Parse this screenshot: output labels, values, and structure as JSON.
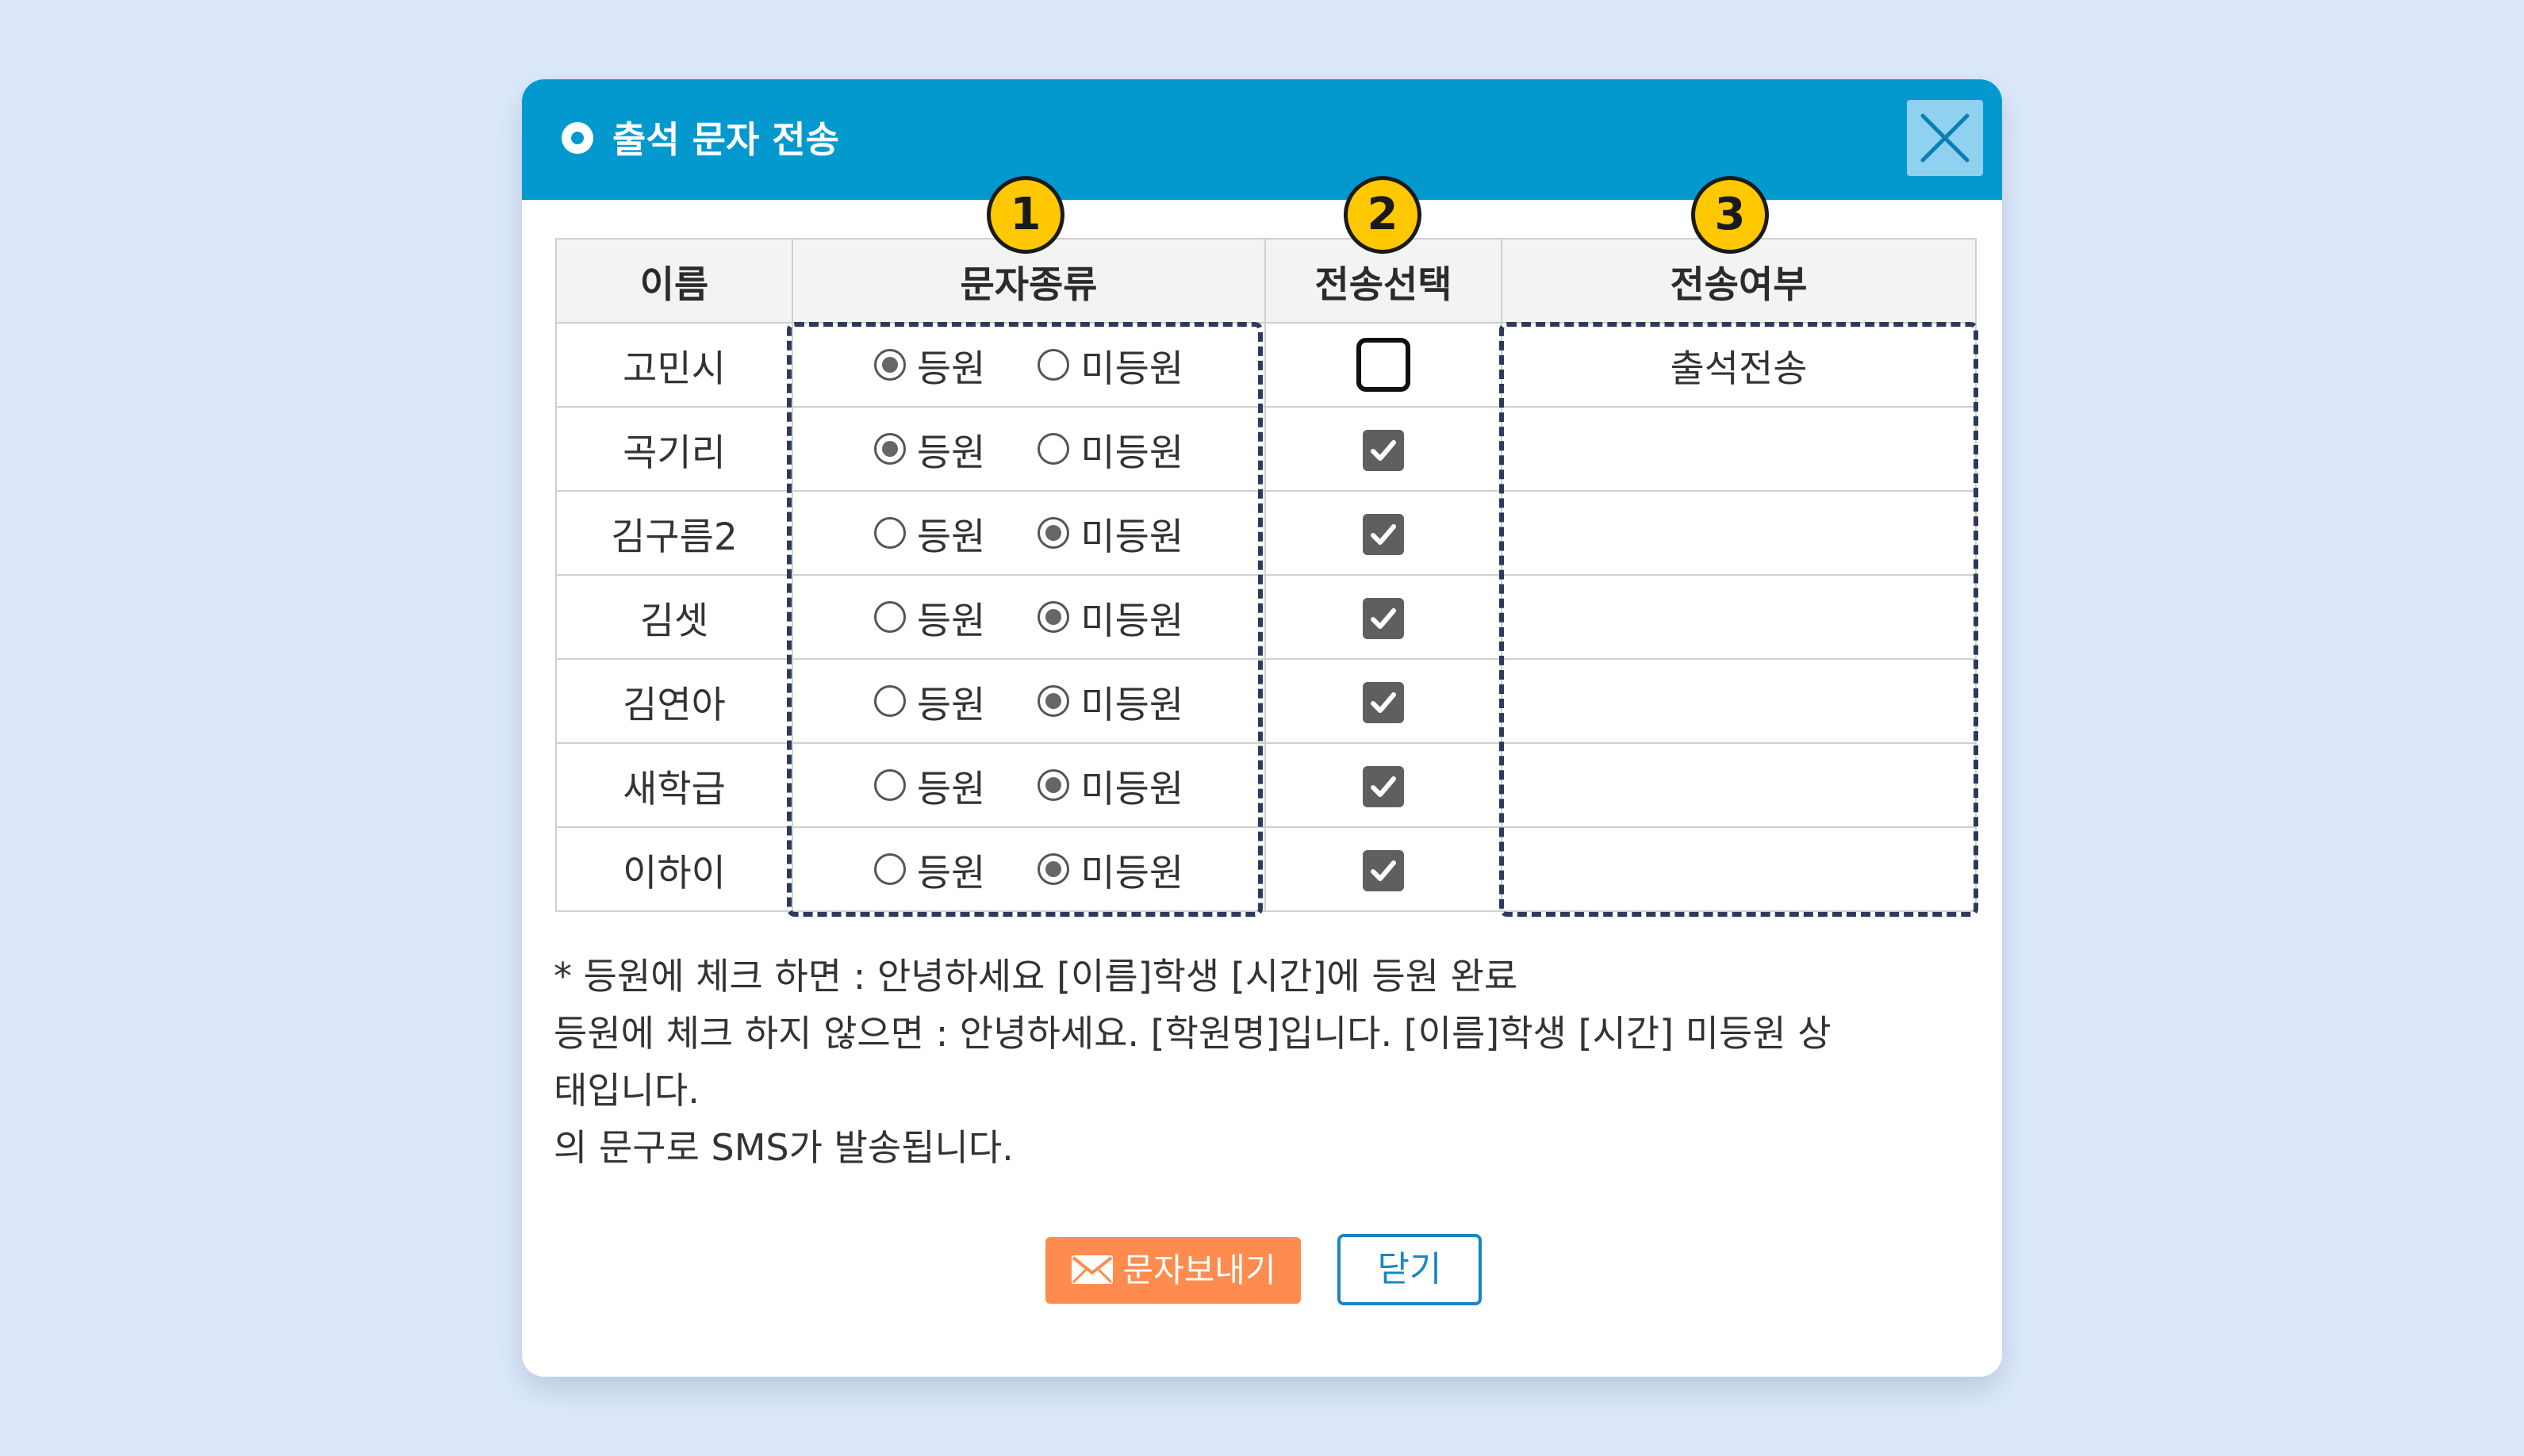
{
  "dialog": {
    "title": "출석 문자 전송",
    "close_icon": "close-x-icon"
  },
  "badges": [
    "1",
    "2",
    "3"
  ],
  "table": {
    "headers": {
      "name": "이름",
      "message_type": "문자종류",
      "send_select": "전송선택",
      "send_status": "전송여부"
    },
    "option_labels": {
      "arrived": "등원",
      "not_arrived": "미등원"
    },
    "rows": [
      {
        "name": "고민시",
        "type_selected": "arrived",
        "send_checked": false,
        "status": "출석전송"
      },
      {
        "name": "곡기리",
        "type_selected": "arrived",
        "send_checked": true,
        "status": ""
      },
      {
        "name": "김구름2",
        "type_selected": "not_arrived",
        "send_checked": true,
        "status": ""
      },
      {
        "name": "김셋",
        "type_selected": "not_arrived",
        "send_checked": true,
        "status": ""
      },
      {
        "name": "김연아",
        "type_selected": "not_arrived",
        "send_checked": true,
        "status": ""
      },
      {
        "name": "새학급",
        "type_selected": "not_arrived",
        "send_checked": true,
        "status": ""
      },
      {
        "name": "이하이",
        "type_selected": "not_arrived",
        "send_checked": true,
        "status": ""
      }
    ]
  },
  "notes": {
    "line1": "* 등원에 체크 하면 : 안녕하세요 [이름]학생 [시간]에 등원 완료",
    "line2": "등원에 체크 하지 않으면 : 안녕하세요. [학원명]입니다. [이름]학생 [시간] 미등원 상",
    "line3": "태입니다.",
    "line4": "의 문구로 SMS가 발송됩니다."
  },
  "buttons": {
    "send_label": "문자보내기",
    "close_label": "닫기"
  },
  "colors": {
    "header_blue": "#0399cf",
    "badge_yellow": "#ffc800",
    "send_orange": "#ff8b4f",
    "close_blue": "#1a86c2",
    "page_bg": "#dde9fb"
  }
}
